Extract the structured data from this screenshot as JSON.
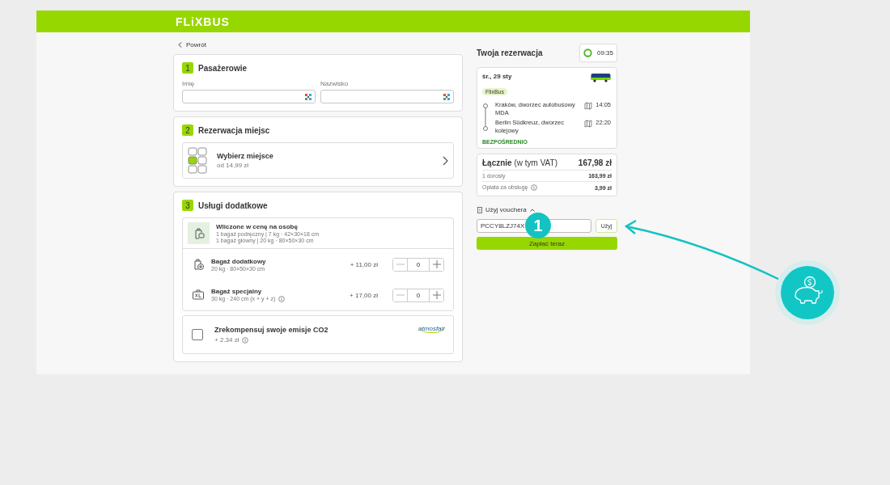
{
  "header": {
    "logo": "FLiXBUS"
  },
  "back_link": "Powrót",
  "passengers": {
    "number": "1",
    "title": "Pasażerowie",
    "fields": [
      {
        "label": "Imię"
      },
      {
        "label": "Nazwisko"
      }
    ]
  },
  "seats": {
    "number": "2",
    "title": "Rezerwacja miejsc",
    "option": {
      "title": "Wybierz miejsce",
      "price": "od 14,99 zł"
    }
  },
  "extras": {
    "number": "3",
    "title": "Usługi dodatkowe",
    "included": {
      "title": "Wliczone w cenę na osobę",
      "lines": [
        "1 bagaż podręczny | 7 kg · 42×30×18 cm",
        "1 bagaż główny | 20 kg · 80×50×30 cm"
      ]
    },
    "items": [
      {
        "kind": "extra-bag",
        "title": "Bagaż dodatkowy",
        "details": "20 kg · 80×50×30 cm",
        "info": false,
        "price": "+ 11,00 zł",
        "quantity": "0"
      },
      {
        "kind": "xl-bag",
        "title": "Bagaż specjalny",
        "details": "30 kg · 240 cm (x + y + z)",
        "info": true,
        "price": "+ 17,00 zł",
        "quantity": "0"
      }
    ],
    "co2": {
      "title": "Zrekompensuj swoje emisje CO2",
      "price": "+ 2.34 zł",
      "checked": false,
      "partner": "atmosfair"
    }
  },
  "booking": {
    "title": "Twoja rezerwacja",
    "timer": "09:35",
    "trip": {
      "date": "śr., 29 sty",
      "operator": "FlixBus",
      "stops": [
        {
          "name": "Kraków, dworzec autobusowy MDA",
          "time": "14:05"
        },
        {
          "name": "Berlin Südkreuz, dworzec kolejowy",
          "time": "22:20"
        }
      ],
      "badge": "BEZPOŚREDNIO"
    },
    "price": {
      "total_label": "**Łącznie** (w tym VAT)",
      "total": "167,98 zł",
      "lines": [
        {
          "label": "1 dorosły",
          "amount": "163,99 zł",
          "info": false
        },
        {
          "label": "Opłata za obsługę",
          "amount": "3,99 zł",
          "info": true
        }
      ]
    },
    "voucher": {
      "toggle": "Użyj vouchera",
      "expanded": true,
      "code": "PCCY8LZJ74X",
      "apply": "Użyj"
    },
    "pay_button": "Zapłać teraz"
  },
  "annotation": {
    "step": "1"
  }
}
